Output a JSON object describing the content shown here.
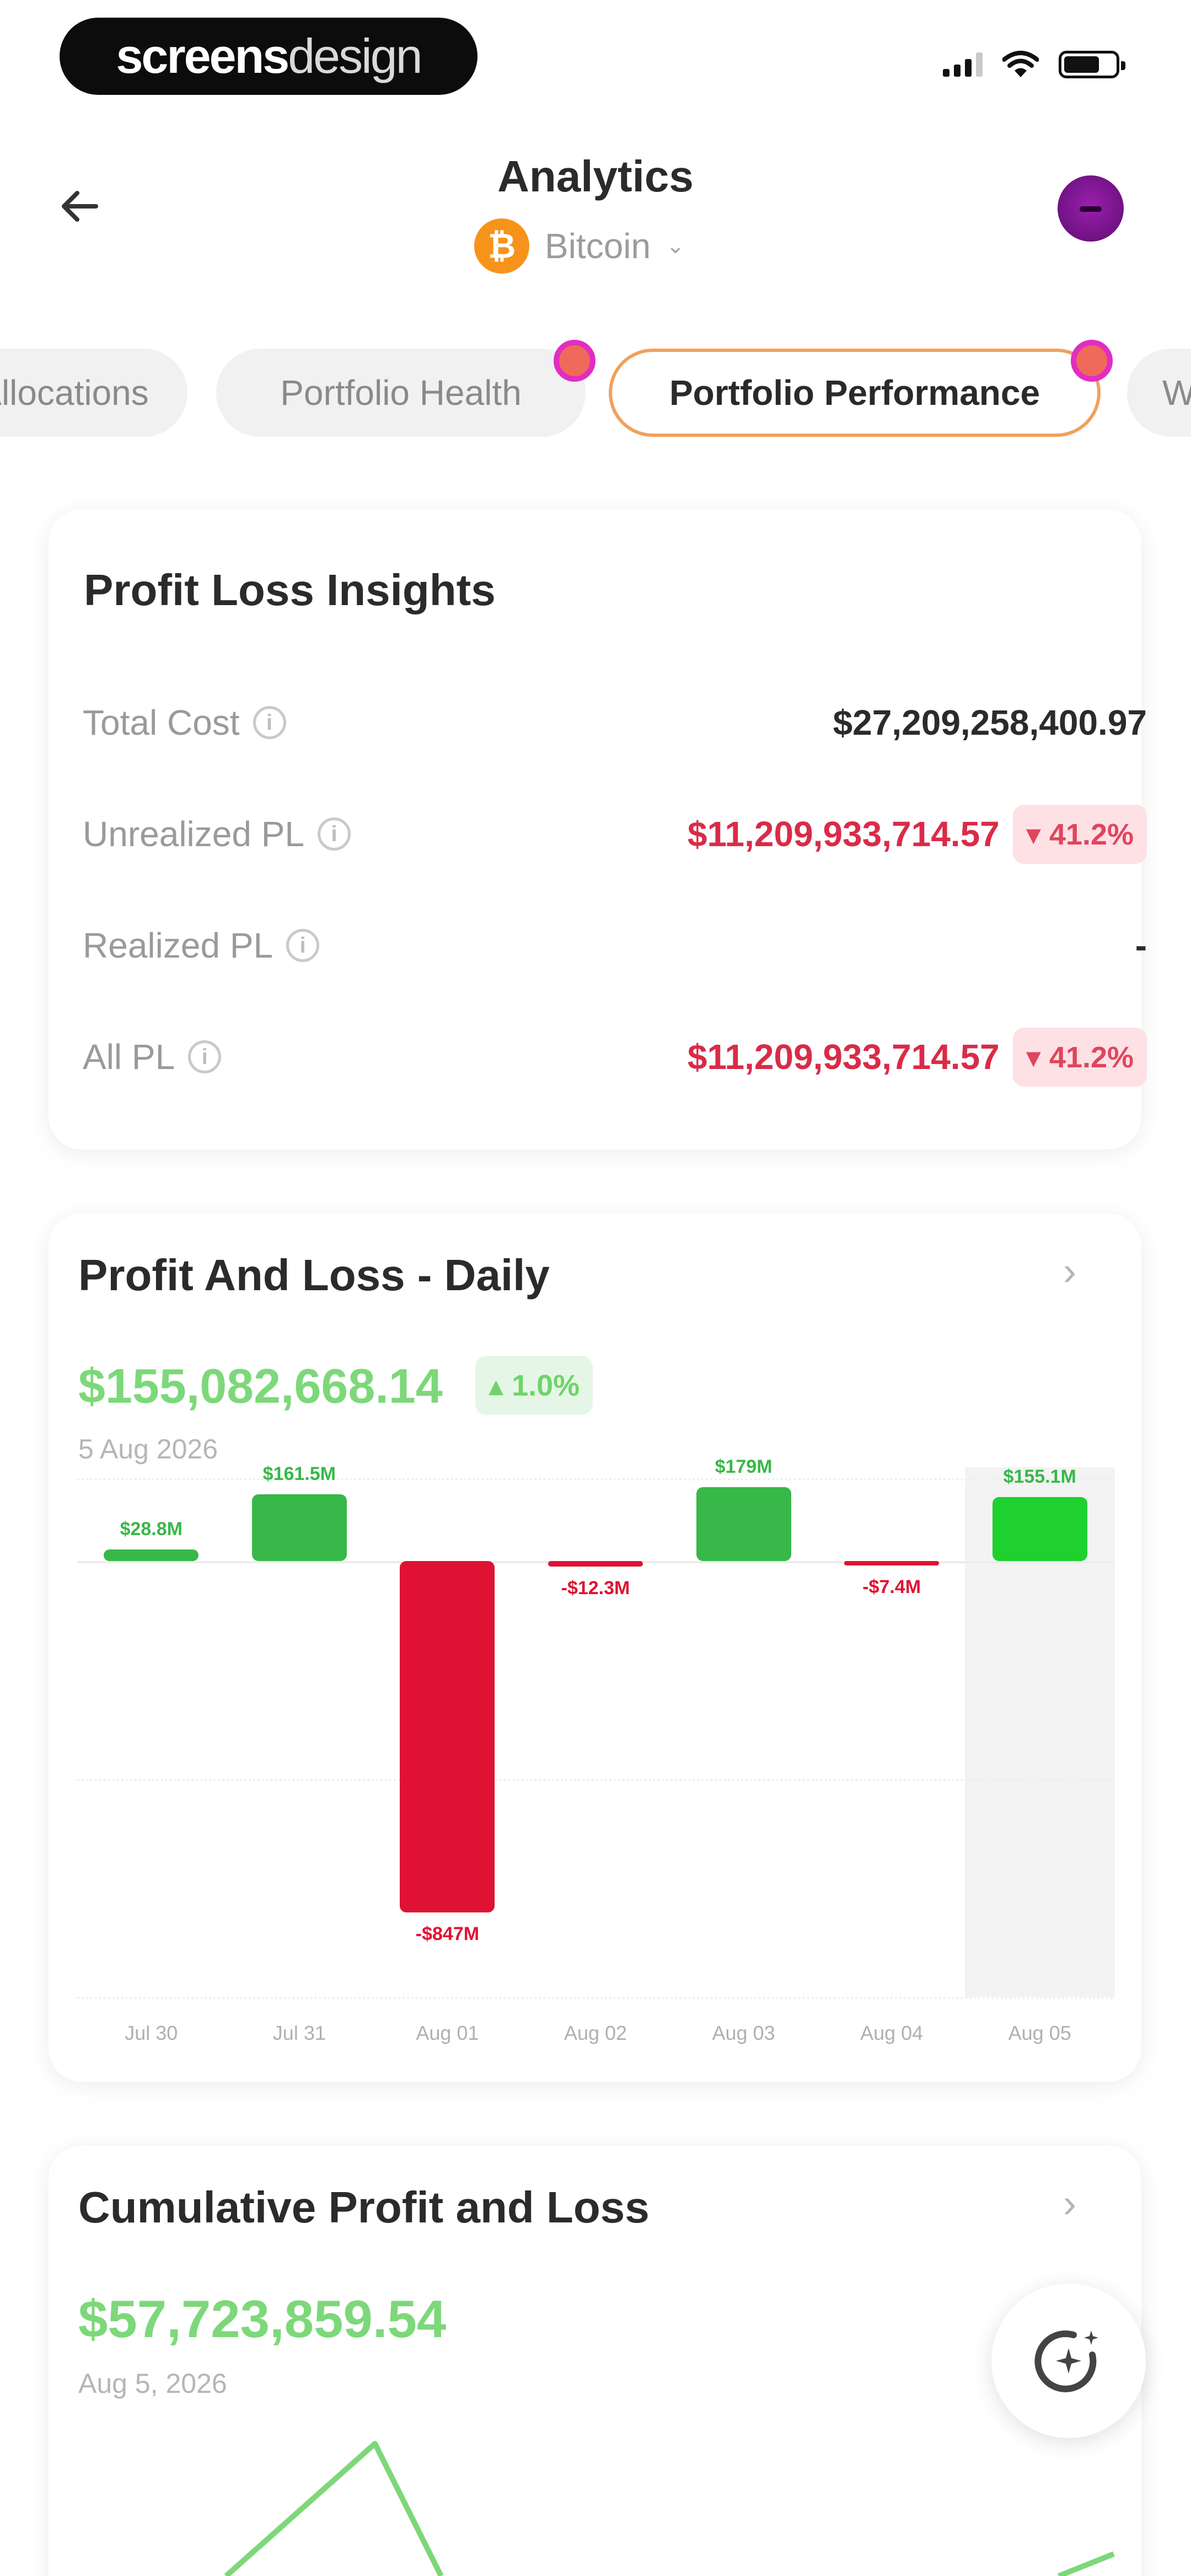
{
  "status_bar": {
    "brand_bold": "screens",
    "brand_light": "design"
  },
  "header": {
    "title": "Analytics",
    "coin_symbol": "₿",
    "coin_name": "Bitcoin"
  },
  "tabs": [
    {
      "label": "Allocations",
      "active": false
    },
    {
      "label": "Portfolio Health",
      "active": false
    },
    {
      "label": "Portfolio Performance",
      "active": true
    },
    {
      "label": "W",
      "active": false
    }
  ],
  "insights": {
    "title": "Profit Loss Insights",
    "rows": [
      {
        "label": "Total Cost",
        "value": "$27,209,258,400.97",
        "badge": ""
      },
      {
        "label": "Unrealized PL",
        "value": "$11,209,933,714.57",
        "badge": "▾ 41.2%"
      },
      {
        "label": "Realized PL",
        "value": "-",
        "badge": ""
      },
      {
        "label": "All PL",
        "value": "$11,209,933,714.57",
        "badge": "▾ 41.2%"
      }
    ]
  },
  "daily": {
    "title": "Profit And Loss - Daily",
    "value": "$155,082,668.14",
    "change_badge": "▴ 1.0%",
    "date": "5 Aug 2026"
  },
  "chart_data": {
    "type": "bar",
    "categories": [
      "Jul 30",
      "Jul 31",
      "Aug 01",
      "Aug 02",
      "Aug 03",
      "Aug 04",
      "Aug 05"
    ],
    "values": [
      28.8,
      161.5,
      -847.0,
      -12.3,
      179.0,
      -7.4,
      155.1
    ],
    "labels": [
      "$28.8M",
      "$161.5M",
      "-$847M",
      "-$12.3M",
      "$179M",
      "-$7.4M",
      "$155.1M"
    ],
    "ylim": [
      -1050,
      200
    ],
    "highlighted_category": "Aug 05",
    "colors": {
      "positive": "#37b848",
      "negative": "#df1233",
      "highlight": "#1ed12e"
    }
  },
  "cumulative": {
    "title": "Cumulative Profit and Loss",
    "value": "$57,723,859.54",
    "date": "Aug 5, 2026"
  }
}
